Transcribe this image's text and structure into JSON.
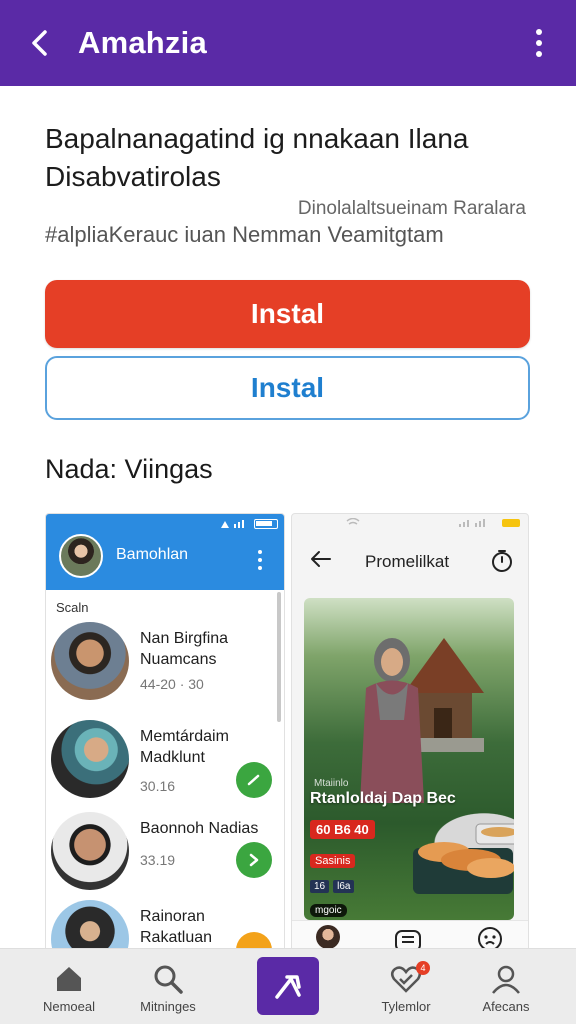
{
  "appbar": {
    "title": "Amahzia",
    "back_icon": "arrow-left-icon",
    "more_icon": "more-vertical-icon"
  },
  "header": {
    "headline": "Bapalnanagatind ig nnakaan Ilana Disabvatirolas",
    "meta_right": "Dinolalaltsueinam Raralara",
    "meta_left": "#alpliaKerauc iuan Nemman Veamitgtam"
  },
  "buttons": {
    "primary_label": "Instal",
    "secondary_label": "Instal"
  },
  "screenshots": {
    "section_title": "Nada: Viingas",
    "left": {
      "header_name": "Bamohlan",
      "section_label": "Scaln",
      "contacts": [
        {
          "name": "Nan Birgfina Nuamcans",
          "time": "44-20 · 30"
        },
        {
          "name": "Memtárdaim Madklunt",
          "time": "30.16"
        },
        {
          "name": "Baonnoh Nadias",
          "time": "33.19"
        },
        {
          "name": "Rainoran Rakatluan",
          "time": ""
        }
      ]
    },
    "right": {
      "title": "Promelilkat",
      "hint": "Mtaiinlo",
      "caption": "Rtanloldaj Dap Bec",
      "price": "60 B6 40",
      "badge": "Sasinis",
      "chips": [
        "16",
        "l6a"
      ],
      "tag": "mgoic"
    }
  },
  "bottomnav": {
    "items": [
      {
        "label": "Nemoeal",
        "icon": "home-icon"
      },
      {
        "label": "Mitninges",
        "icon": "search-icon"
      },
      {
        "label": "",
        "icon": "create-icon"
      },
      {
        "label": "Tylemlor",
        "icon": "heart-icon",
        "badge": "4"
      },
      {
        "label": "Afecans",
        "icon": "profile-icon"
      }
    ]
  },
  "colors": {
    "brand": "#5a2aa6",
    "primary_button": "#e53f26",
    "outline_button": "#1f7fcf",
    "left_header": "#2b8be0",
    "go_green": "#3ba640",
    "go_orange": "#f3a21a"
  }
}
